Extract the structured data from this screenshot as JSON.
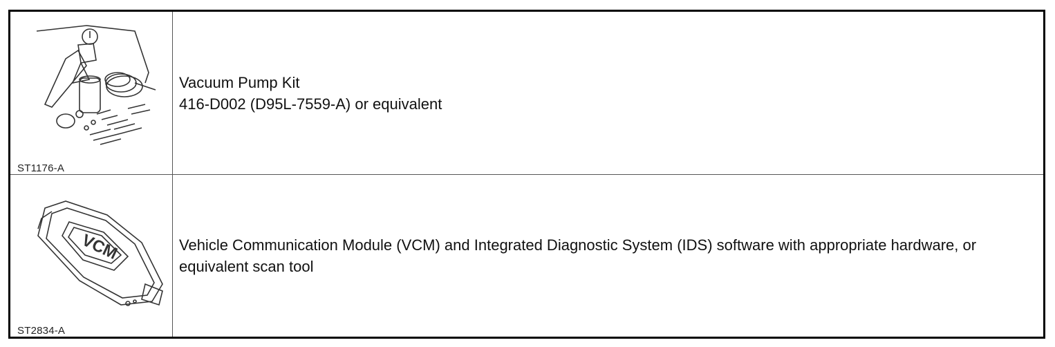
{
  "rows": [
    {
      "figure_label": "ST1176-A",
      "figure_icon": "vacuum-pump-kit-illustration",
      "lines": [
        "Vacuum Pump Kit",
        "416-D002 (D95L-7559-A) or equivalent"
      ]
    },
    {
      "figure_label": "ST2834-A",
      "figure_icon": "vcm-module-illustration",
      "figure_text": "VCM",
      "lines": [
        "Vehicle Communication Module (VCM) and Integrated Diagnostic System (IDS) software with appropriate hardware, or equivalent scan tool"
      ]
    }
  ]
}
